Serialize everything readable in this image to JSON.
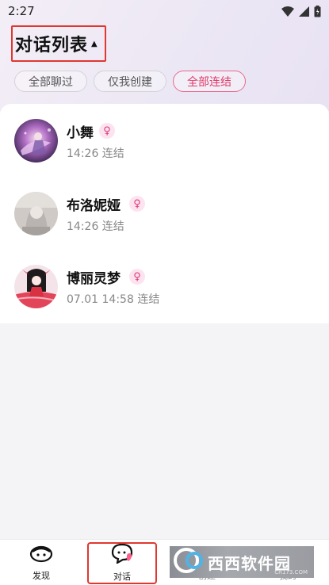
{
  "status_bar": {
    "time": "2:27"
  },
  "header": {
    "title": "对话列表"
  },
  "filters": [
    {
      "label": "全部聊过",
      "active": false
    },
    {
      "label": "仅我创建",
      "active": false
    },
    {
      "label": "全部连结",
      "active": true
    }
  ],
  "conversations": [
    {
      "name": "小舞",
      "gender": "♀",
      "subtitle": "14:26 连结"
    },
    {
      "name": "布洛妮娅",
      "gender": "♀",
      "subtitle": "14:26 连结"
    },
    {
      "name": "博丽灵梦",
      "gender": "♀",
      "subtitle": "07.01 14:58 连结"
    }
  ],
  "bottom_nav": {
    "items": [
      {
        "label": "发现",
        "icon": "discover-icon"
      },
      {
        "label": "对话",
        "icon": "chat-icon"
      },
      {
        "label": "创建",
        "icon": "create-icon"
      },
      {
        "label": "我的",
        "icon": "profile-icon"
      }
    ]
  },
  "watermark": {
    "brand": "西西软件园",
    "url": "CR173.COM"
  },
  "colors": {
    "accent": "#e23a67",
    "highlight_border": "#e0372f"
  }
}
